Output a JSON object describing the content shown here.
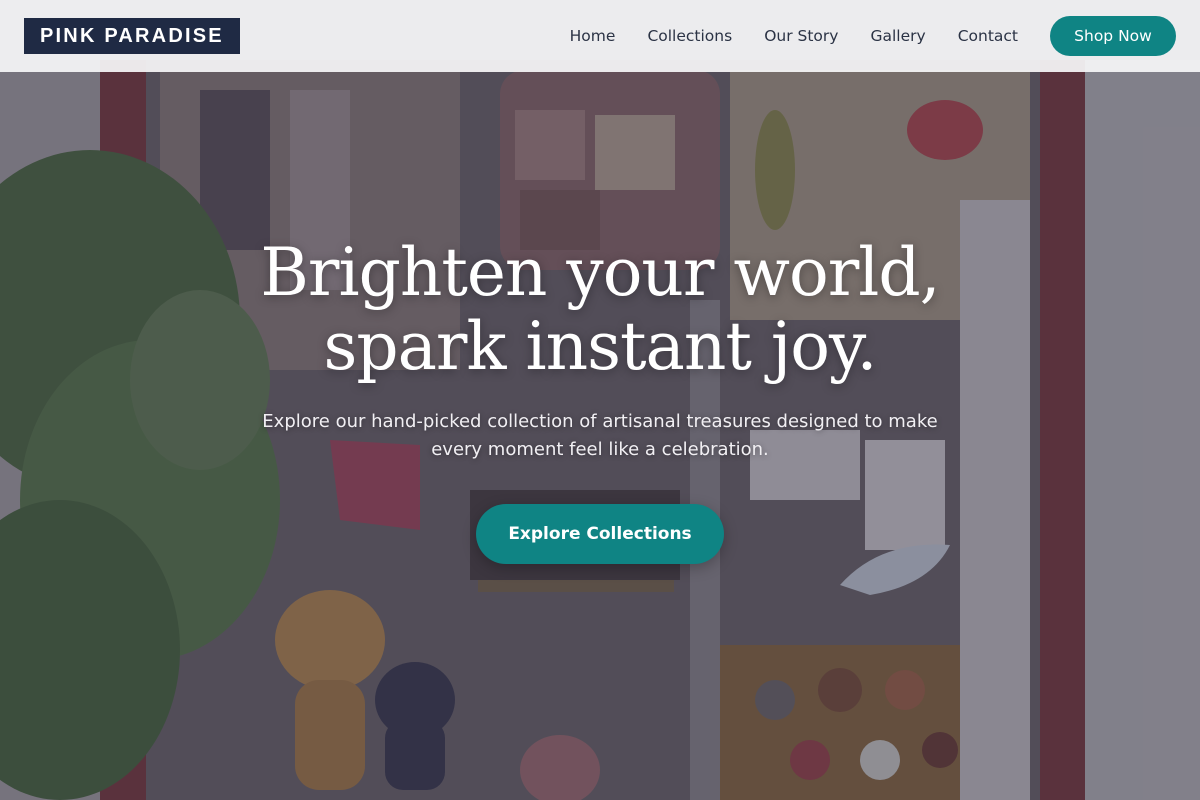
{
  "brand": {
    "logo_text": "PINK PARADISE"
  },
  "nav": {
    "items": [
      {
        "label": "Home"
      },
      {
        "label": "Collections"
      },
      {
        "label": "Our Story"
      },
      {
        "label": "Gallery"
      },
      {
        "label": "Contact"
      }
    ],
    "cta_label": "Shop Now"
  },
  "hero": {
    "title_line1": "Brighten your world,",
    "title_line2": "spark instant joy.",
    "subtitle": "Explore our hand-picked collection of artisanal treasures designed to make every moment feel like a celebration.",
    "cta_label": "Explore Collections"
  },
  "colors": {
    "brand_navy": "#1f2a44",
    "accent_teal": "#0f8484",
    "header_bg": "#f6f6f7"
  }
}
